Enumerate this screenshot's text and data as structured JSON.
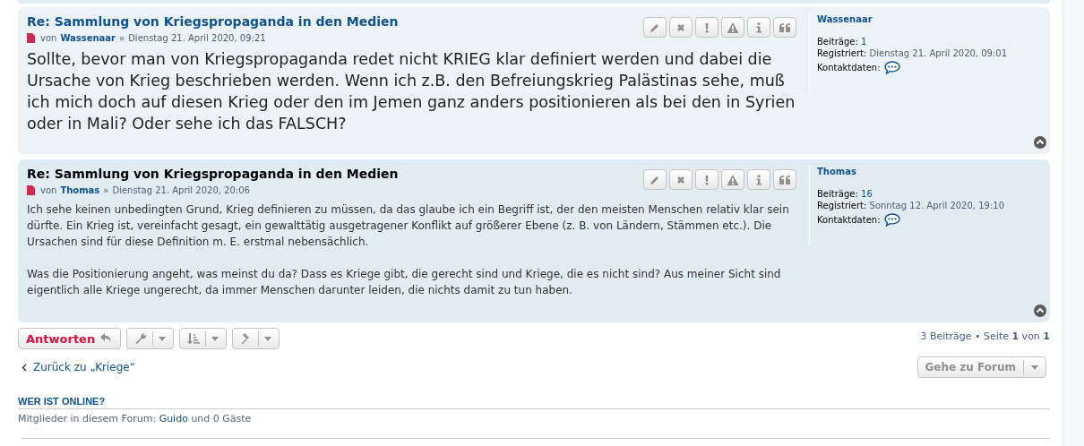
{
  "posts": [
    {
      "title": "Re: Sammlung von Kriegspropaganda in den Medien",
      "alternate": false,
      "large_text": true,
      "by": "von",
      "author": "Wassenaar",
      "sep": "»",
      "date": "Dienstag 21. April 2020, 09:21",
      "paragraphs": [
        "Sollte, bevor man von Kriegspropaganda redet nicht KRIEG klar definiert werden und dabei die Ursache von Krieg beschrieben werden. Wenn ich z.B. den Befreiungskrieg Palästinas sehe, muß ich mich doch auf diesen Krieg oder den im Jemen ganz anders positionieren als bei den in Syrien oder in Mali? Oder sehe ich das FALSCH?"
      ],
      "profile": {
        "name": "Wassenaar",
        "posts_label": "Beiträge:",
        "posts": "1",
        "registered_label": "Registriert:",
        "registered": "Dienstag 21. April 2020, 09:01",
        "contact_label": "Kontaktdaten:"
      }
    },
    {
      "title": "Re: Sammlung von Kriegspropaganda in den Medien",
      "alternate": true,
      "large_text": false,
      "by": "von",
      "author": "Thomas",
      "sep": "»",
      "date": "Dienstag 21. April 2020, 20:06",
      "paragraphs": [
        "Ich sehe keinen unbedingten Grund, Krieg definieren zu müssen, da das glaube ich ein Begriff ist, der den meisten Menschen relativ klar sein dürfte. Ein Krieg ist, vereinfacht gesagt, ein gewalttätig ausgetragener Konflikt auf größerer Ebene (z. B. von Ländern, Stämmen etc.). Die Ursachen sind für diese Definition m. E. erstmal nebensächlich.",
        "Was die Positionierung angeht, was meinst du da? Dass es Kriege gibt, die gerecht sind und Kriege, die es nicht sind? Aus meiner Sicht sind eigentlich alle Kriege ungerecht, da immer Menschen darunter leiden, die nichts damit zu tun haben."
      ],
      "profile": {
        "name": "Thomas",
        "posts_label": "Beiträge:",
        "posts": "16",
        "registered_label": "Registriert:",
        "registered": "Sonntag 12. April 2020, 19:10",
        "contact_label": "Kontaktdaten:"
      }
    }
  ],
  "reply_button": "Antworten",
  "pagination": "3 Beiträge • Seite **1** von **1**",
  "back_link": "Zurück zu „Kriege“",
  "jump_button": "Gehe zu Forum",
  "online": {
    "heading": "WER IST ONLINE?",
    "prefix": "Mitglieder in diesem Forum:",
    "user": "Guido",
    "suffix": "und 0 Gäste"
  }
}
